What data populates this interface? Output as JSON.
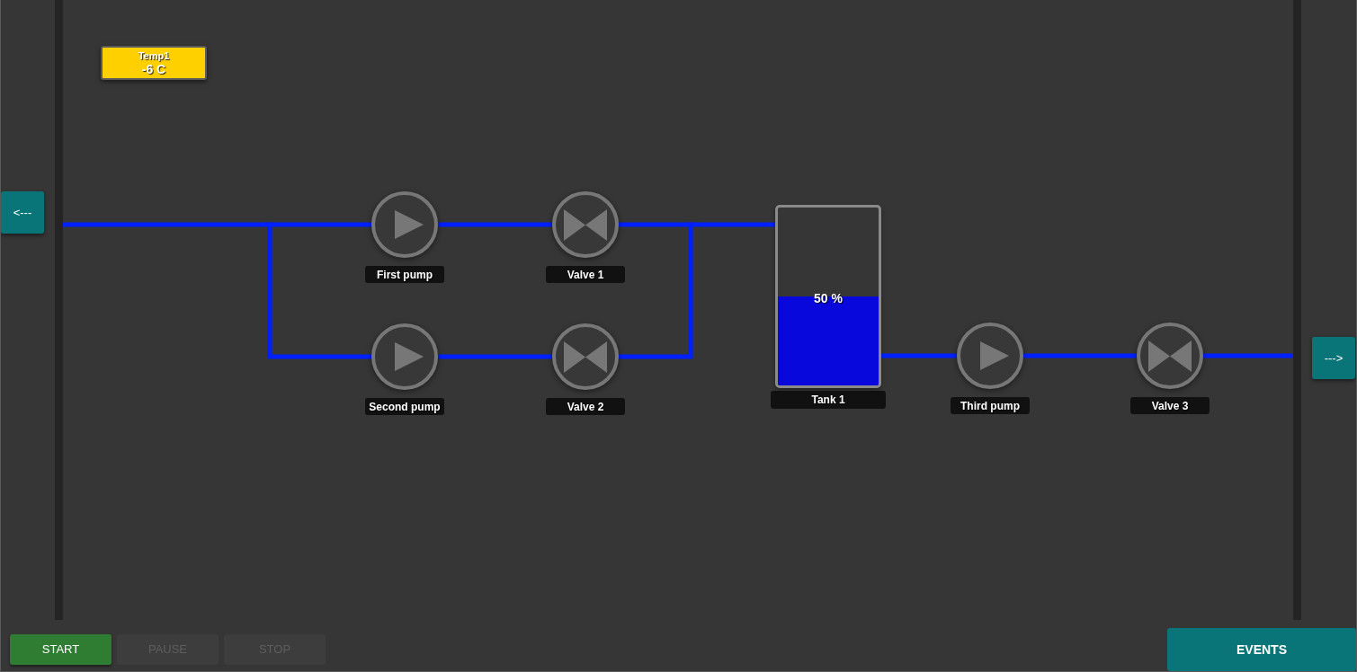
{
  "navigation": {
    "back_button": "<---",
    "forward_button": "--->"
  },
  "sensors": [
    {
      "name": "Temp1",
      "reading": "-6 C"
    }
  ],
  "diagram": {
    "nodes": [
      {
        "kind": "pump",
        "label": "First pump"
      },
      {
        "kind": "valve",
        "label": "Valve 1"
      },
      {
        "kind": "pump",
        "label": "Second pump"
      },
      {
        "kind": "valve",
        "label": "Valve 2"
      },
      {
        "kind": "tank",
        "label": "Tank 1",
        "level": 0.5,
        "reading": "50 %"
      },
      {
        "kind": "pump",
        "label": "Third pump"
      },
      {
        "kind": "valve",
        "label": "Valve 3"
      }
    ]
  },
  "controls": [
    {
      "label": "START",
      "disabled": false
    },
    {
      "label": "PAUSE",
      "disabled": true
    },
    {
      "label": "STOP",
      "disabled": true
    }
  ],
  "events_button": "EVENTS"
}
